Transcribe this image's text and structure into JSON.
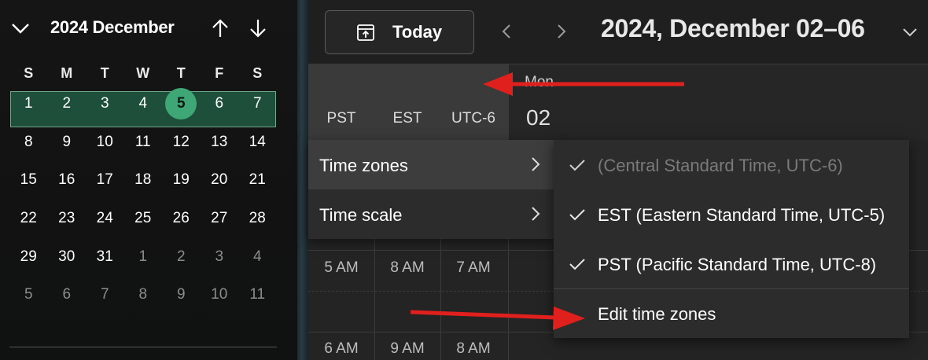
{
  "mini_calendar": {
    "month_label": "2024 December",
    "weekday_headers": [
      "S",
      "M",
      "T",
      "W",
      "T",
      "F",
      "S"
    ],
    "weeks": [
      [
        {
          "d": "1",
          "o": false
        },
        {
          "d": "2",
          "o": false
        },
        {
          "d": "3",
          "o": false
        },
        {
          "d": "4",
          "o": false
        },
        {
          "d": "5",
          "o": false,
          "today": true
        },
        {
          "d": "6",
          "o": false
        },
        {
          "d": "7",
          "o": false
        }
      ],
      [
        {
          "d": "8",
          "o": false
        },
        {
          "d": "9",
          "o": false
        },
        {
          "d": "10",
          "o": false
        },
        {
          "d": "11",
          "o": false
        },
        {
          "d": "12",
          "o": false
        },
        {
          "d": "13",
          "o": false
        },
        {
          "d": "14",
          "o": false
        }
      ],
      [
        {
          "d": "15",
          "o": false
        },
        {
          "d": "16",
          "o": false
        },
        {
          "d": "17",
          "o": false
        },
        {
          "d": "18",
          "o": false
        },
        {
          "d": "19",
          "o": false
        },
        {
          "d": "20",
          "o": false
        },
        {
          "d": "21",
          "o": false
        }
      ],
      [
        {
          "d": "22",
          "o": false
        },
        {
          "d": "23",
          "o": false
        },
        {
          "d": "24",
          "o": false
        },
        {
          "d": "25",
          "o": false
        },
        {
          "d": "26",
          "o": false
        },
        {
          "d": "27",
          "o": false
        },
        {
          "d": "28",
          "o": false
        }
      ],
      [
        {
          "d": "29",
          "o": false
        },
        {
          "d": "30",
          "o": false
        },
        {
          "d": "31",
          "o": false
        },
        {
          "d": "1",
          "o": true
        },
        {
          "d": "2",
          "o": true
        },
        {
          "d": "3",
          "o": true
        },
        {
          "d": "4",
          "o": true
        }
      ],
      [
        {
          "d": "5",
          "o": true
        },
        {
          "d": "6",
          "o": true
        },
        {
          "d": "7",
          "o": true
        },
        {
          "d": "8",
          "o": true
        },
        {
          "d": "9",
          "o": true
        },
        {
          "d": "10",
          "o": true
        },
        {
          "d": "11",
          "o": true
        }
      ]
    ],
    "selected_week": 1,
    "today": "5"
  },
  "toolbar": {
    "today_label": "Today",
    "range_title": "2024, December 02–06"
  },
  "time_zones": {
    "columns": [
      "PST",
      "EST",
      "UTC-6"
    ],
    "rows": [
      [
        "5 AM",
        "8 AM",
        "7 AM"
      ],
      [
        "6 AM",
        "9 AM",
        "8 AM"
      ]
    ]
  },
  "day_header": {
    "name": "Mon",
    "number": "02"
  },
  "context_menu": {
    "items": [
      {
        "label": "Time zones",
        "active": true
      },
      {
        "label": "Time scale",
        "active": false
      }
    ]
  },
  "submenu": {
    "items": [
      {
        "label": "(Central Standard Time, UTC-6)",
        "checked": true,
        "disabled": true
      },
      {
        "label": "EST (Eastern Standard Time, UTC-5)",
        "checked": true,
        "disabled": false
      },
      {
        "label": "PST (Pacific Standard Time, UTC-8)",
        "checked": true,
        "disabled": false
      }
    ],
    "action": "Edit time zones"
  },
  "colors": {
    "accent": "#3ea775",
    "selected_week": "#1d4f3a",
    "annotation_arrow": "#e0201c"
  },
  "icons": [
    "chevron-down-icon",
    "arrow-up-icon",
    "arrow-down-icon",
    "calendar-today-icon",
    "chevron-left-icon",
    "chevron-right-icon",
    "checkmark-icon"
  ]
}
